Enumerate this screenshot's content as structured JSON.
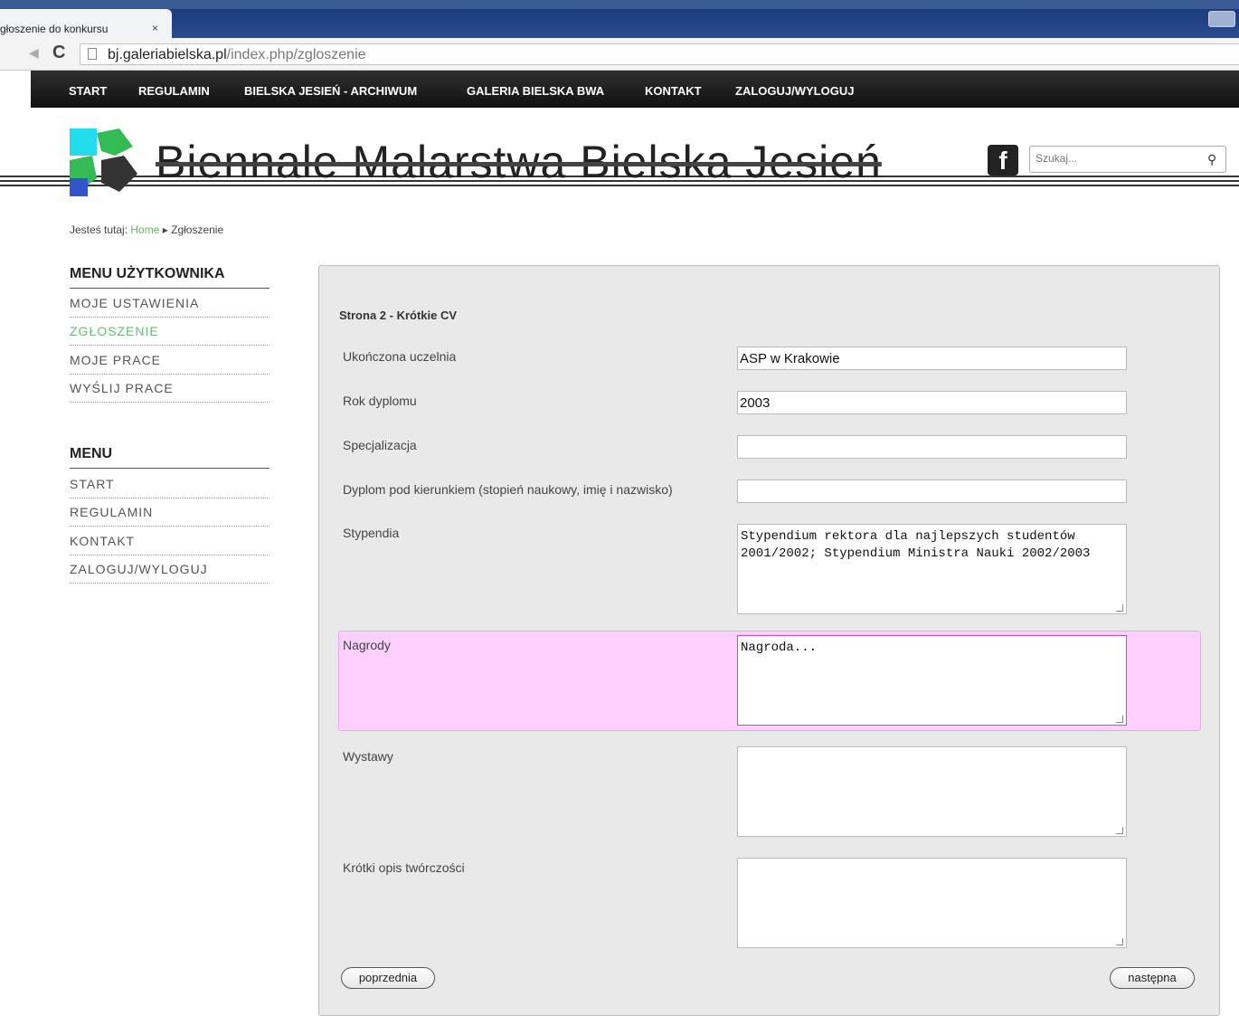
{
  "browser": {
    "tab_title": "głoszenie do konkursu",
    "tab_close": "×",
    "url_host": "bj.galeriabielska.pl",
    "url_path": "/index.php/zgloszenie",
    "back": "◀",
    "reload": "C"
  },
  "nav": {
    "items": [
      "START",
      "REGULAMIN",
      "BIELSKA JESIEŃ - ARCHIWUM",
      "GALERIA BIELSKA BWA",
      "KONTAKT",
      "ZALOGUJ/WYLOGUJ"
    ]
  },
  "header": {
    "site_title": "Biennale Malarstwa Bielska Jesień",
    "facebook_icon": "f",
    "search_placeholder": "Szukaj...",
    "search_icon": "⚲"
  },
  "breadcrumb": {
    "prefix": "Jesteś tutaj:",
    "home": "Home",
    "separator": "▸",
    "current": "Zgłoszenie"
  },
  "sidebar": {
    "user_menu_title": "MENU UŻYTKOWNIKA",
    "user_menu": [
      "MOJE USTAWIENIA",
      "ZGŁOSZENIE",
      "MOJE PRACE",
      "WYŚLIJ PRACE"
    ],
    "menu_title": "MENU",
    "menu": [
      "START",
      "REGULAMIN",
      "KONTAKT",
      "ZALOGUJ/WYLOGUJ"
    ]
  },
  "form": {
    "heading": "Strona 2 - Krótkie CV",
    "fields": [
      {
        "label": "Ukończona uczelnia",
        "value": "ASP w Krakowie"
      },
      {
        "label": "Rok dyplomu",
        "value": "2003"
      },
      {
        "label": "Specjalizacja",
        "value": ""
      },
      {
        "label": "Dyplom pod kierunkiem (stopień naukowy, imię i nazwisko)",
        "value": ""
      },
      {
        "label": "Stypendia",
        "value": "Stypendium rektora dla najlepszych studentów 2001/2002; Stypendium Ministra Nauki 2002/2003"
      },
      {
        "label": "Nagrody",
        "value": "Nagroda..."
      },
      {
        "label": "Wystawy",
        "value": ""
      },
      {
        "label": "Krótki opis twórczości",
        "value": ""
      }
    ],
    "prev_button": "poprzednia",
    "next_button": "następna"
  },
  "colors": {
    "nav_bg": "#1a1a1a",
    "active_menu": "#6aba7a",
    "highlight": "#fdd0fd",
    "panel_bg": "#e9e9e9"
  }
}
